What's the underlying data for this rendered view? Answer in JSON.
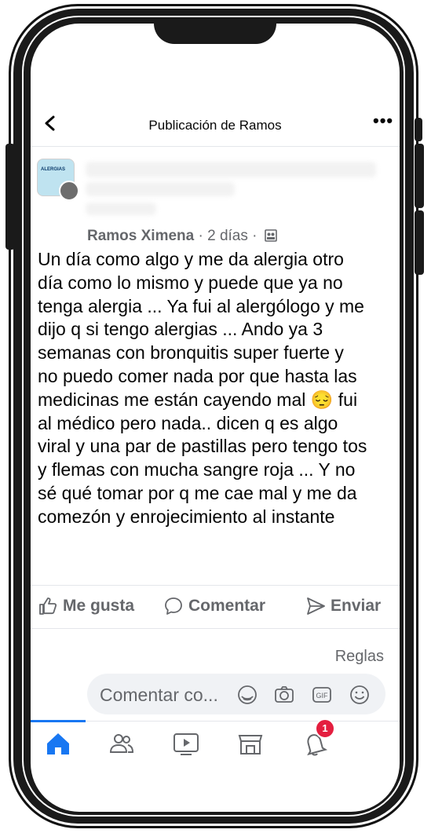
{
  "header": {
    "title": "Publicación de Ramos"
  },
  "post": {
    "author": "Ramos Ximena",
    "meta": " · 2 días · ",
    "avatar_text": "ALERGIAS",
    "text": "Un día como algo y me da alergia otro\ndía como lo mismo y puede que ya no\ntenga alergia ... Ya fui al alergólogo y me\ndijo q si tengo alergias ... Ando ya 3\nsemanas con bronquitis super fuerte y\nno puedo comer nada por que hasta las\nmedicinas me están cayendo mal 😔 fui\nal médico pero nada.. dicen q es algo\nviral y una par de pastillas pero tengo tos\ny flemas  con mucha sangre roja ... Y no\nsé qué tomar por q me cae mal y me da\ncomezón y enrojecimiento al instante"
  },
  "actions": {
    "like": "Me gusta",
    "comment": "Comentar",
    "share": "Enviar"
  },
  "rules_link": "Reglas",
  "comment_box": {
    "placeholder": "Comentar co..."
  },
  "tabbar": {
    "items": [
      "home-icon",
      "friends-icon",
      "video-icon",
      "marketplace-icon",
      "notifications-icon"
    ],
    "notifications_badge": "1",
    "accent_color": "#1877f2"
  }
}
